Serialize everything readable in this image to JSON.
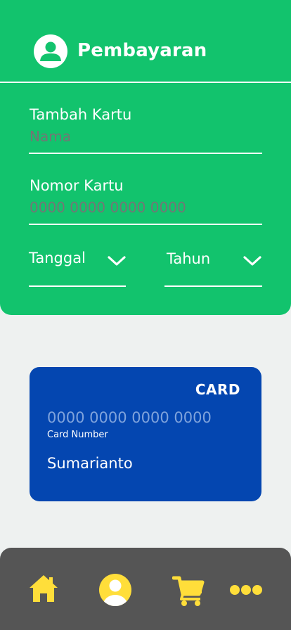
{
  "header": {
    "title": "Pembayaran",
    "avatar_icon": "user-icon"
  },
  "form": {
    "add_card_label": "Tambah Kartu",
    "name_placeholder": "Nama",
    "card_number_label": "Nomor Kartu",
    "card_number_placeholder": "0000 0000 0000 0000",
    "date_label": "Tanggal",
    "year_label": "Tahun"
  },
  "card": {
    "brand": "CARD",
    "number": "0000 0000 0000 0000",
    "number_label": "Card Number",
    "holder": "Sumarianto"
  },
  "bottom_nav": {
    "items": [
      {
        "icon": "home-icon"
      },
      {
        "icon": "profile-icon"
      },
      {
        "icon": "cart-icon"
      },
      {
        "icon": "more-icon"
      }
    ]
  },
  "colors": {
    "primary_green": "#12c36d",
    "card_blue": "#0446b0",
    "nav_background": "#555555",
    "nav_icon_yellow": "#ffde3a",
    "placeholder_green": "#6fe0a8"
  }
}
